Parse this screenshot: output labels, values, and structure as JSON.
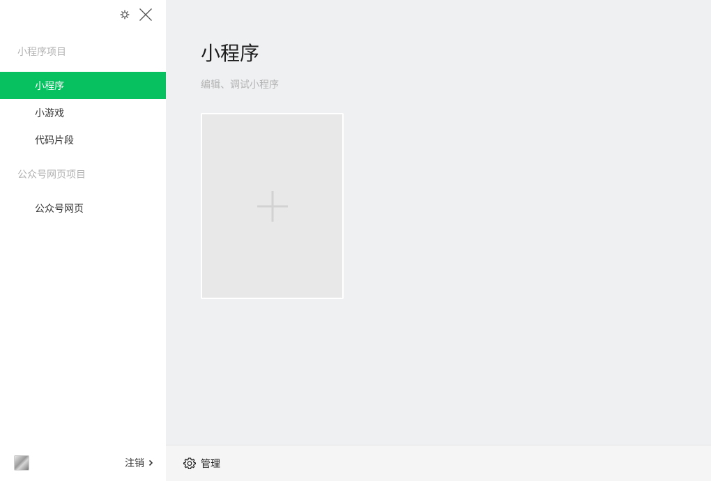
{
  "sidebar": {
    "section_miniprogram": "小程序项目",
    "items_miniprogram": [
      {
        "label": "小程序",
        "active": true
      },
      {
        "label": "小游戏",
        "active": false
      },
      {
        "label": "代码片段",
        "active": false
      }
    ],
    "section_official": "公众号网页项目",
    "items_official": [
      {
        "label": "公众号网页",
        "active": false
      }
    ],
    "footer": {
      "logout_label": "注销"
    }
  },
  "window_controls": {
    "settings_icon": "gear-icon",
    "close_icon": "close-icon"
  },
  "main": {
    "title": "小程序",
    "subtitle": "编辑、调试小程序",
    "new_card_icon": "plus-icon"
  },
  "bottom_bar": {
    "manage_label": "管理"
  },
  "colors": {
    "accent": "#07c160",
    "main_bg": "#eff0f2",
    "muted_text": "#b2b2b2"
  }
}
